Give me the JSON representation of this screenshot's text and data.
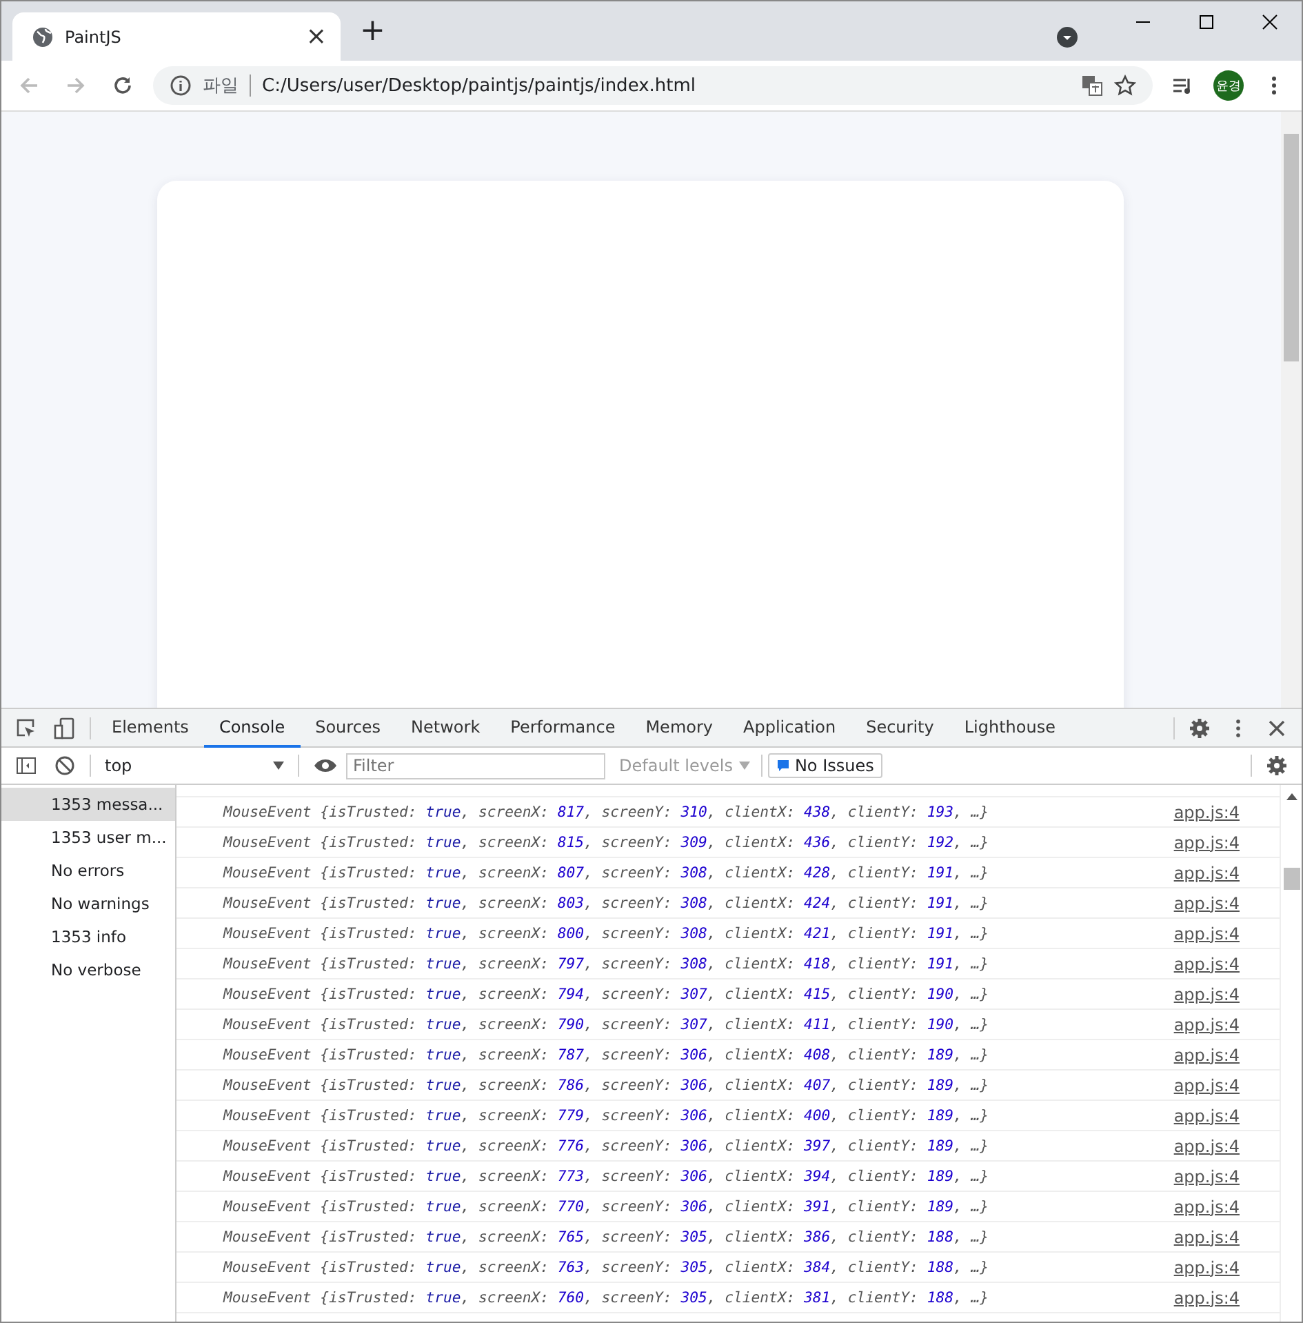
{
  "browser": {
    "tab": {
      "title": "PaintJS",
      "close": "×"
    },
    "new_tab": "+",
    "address": {
      "scheme_label": "파일",
      "url": "C:/Users/user/Desktop/paintjs/paintjs/index.html"
    },
    "profile": "윤경"
  },
  "devtools": {
    "tabs": [
      {
        "label": "Elements",
        "selected": false
      },
      {
        "label": "Console",
        "selected": true
      },
      {
        "label": "Sources",
        "selected": false
      },
      {
        "label": "Network",
        "selected": false
      },
      {
        "label": "Performance",
        "selected": false
      },
      {
        "label": "Memory",
        "selected": false
      },
      {
        "label": "Application",
        "selected": false
      },
      {
        "label": "Security",
        "selected": false
      },
      {
        "label": "Lighthouse",
        "selected": false
      }
    ],
    "context": "top",
    "filter_placeholder": "Filter",
    "levels": "Default levels",
    "issues": "No Issues",
    "sidebar": [
      {
        "label": "1353 messa...",
        "selected": true
      },
      {
        "label": "1353 user m...",
        "selected": false
      },
      {
        "label": "No errors",
        "selected": false
      },
      {
        "label": "No warnings",
        "selected": false
      },
      {
        "label": "1353 info",
        "selected": false
      },
      {
        "label": "No verbose",
        "selected": false
      }
    ],
    "messages": [
      {
        "parts": [
          {
            "text": "MouseEvent {isTrusted: ",
            "kind": "key"
          },
          {
            "text": "true",
            "kind": "bool"
          },
          {
            "text": ", screenX: ",
            "kind": "key"
          },
          {
            "text": "817",
            "kind": "num"
          },
          {
            "text": ", screenY: ",
            "kind": "key"
          },
          {
            "text": "310",
            "kind": "num"
          },
          {
            "text": ", clientX: ",
            "kind": "key"
          },
          {
            "text": "438",
            "kind": "num"
          },
          {
            "text": ", clientY: ",
            "kind": "key"
          },
          {
            "text": "193",
            "kind": "num"
          },
          {
            "text": ", …}",
            "kind": "key"
          }
        ],
        "source": "app.js:4"
      },
      {
        "parts": [
          {
            "text": "MouseEvent {isTrusted: ",
            "kind": "key"
          },
          {
            "text": "true",
            "kind": "bool"
          },
          {
            "text": ", screenX: ",
            "kind": "key"
          },
          {
            "text": "815",
            "kind": "num"
          },
          {
            "text": ", screenY: ",
            "kind": "key"
          },
          {
            "text": "309",
            "kind": "num"
          },
          {
            "text": ", clientX: ",
            "kind": "key"
          },
          {
            "text": "436",
            "kind": "num"
          },
          {
            "text": ", clientY: ",
            "kind": "key"
          },
          {
            "text": "192",
            "kind": "num"
          },
          {
            "text": ", …}",
            "kind": "key"
          }
        ],
        "source": "app.js:4"
      },
      {
        "parts": [
          {
            "text": "MouseEvent {isTrusted: ",
            "kind": "key"
          },
          {
            "text": "true",
            "kind": "bool"
          },
          {
            "text": ", screenX: ",
            "kind": "key"
          },
          {
            "text": "807",
            "kind": "num"
          },
          {
            "text": ", screenY: ",
            "kind": "key"
          },
          {
            "text": "308",
            "kind": "num"
          },
          {
            "text": ", clientX: ",
            "kind": "key"
          },
          {
            "text": "428",
            "kind": "num"
          },
          {
            "text": ", clientY: ",
            "kind": "key"
          },
          {
            "text": "191",
            "kind": "num"
          },
          {
            "text": ", …}",
            "kind": "key"
          }
        ],
        "source": "app.js:4"
      },
      {
        "parts": [
          {
            "text": "MouseEvent {isTrusted: ",
            "kind": "key"
          },
          {
            "text": "true",
            "kind": "bool"
          },
          {
            "text": ", screenX: ",
            "kind": "key"
          },
          {
            "text": "803",
            "kind": "num"
          },
          {
            "text": ", screenY: ",
            "kind": "key"
          },
          {
            "text": "308",
            "kind": "num"
          },
          {
            "text": ", clientX: ",
            "kind": "key"
          },
          {
            "text": "424",
            "kind": "num"
          },
          {
            "text": ", clientY: ",
            "kind": "key"
          },
          {
            "text": "191",
            "kind": "num"
          },
          {
            "text": ", …}",
            "kind": "key"
          }
        ],
        "source": "app.js:4"
      },
      {
        "parts": [
          {
            "text": "MouseEvent {isTrusted: ",
            "kind": "key"
          },
          {
            "text": "true",
            "kind": "bool"
          },
          {
            "text": ", screenX: ",
            "kind": "key"
          },
          {
            "text": "800",
            "kind": "num"
          },
          {
            "text": ", screenY: ",
            "kind": "key"
          },
          {
            "text": "308",
            "kind": "num"
          },
          {
            "text": ", clientX: ",
            "kind": "key"
          },
          {
            "text": "421",
            "kind": "num"
          },
          {
            "text": ", clientY: ",
            "kind": "key"
          },
          {
            "text": "191",
            "kind": "num"
          },
          {
            "text": ", …}",
            "kind": "key"
          }
        ],
        "source": "app.js:4"
      },
      {
        "parts": [
          {
            "text": "MouseEvent {isTrusted: ",
            "kind": "key"
          },
          {
            "text": "true",
            "kind": "bool"
          },
          {
            "text": ", screenX: ",
            "kind": "key"
          },
          {
            "text": "797",
            "kind": "num"
          },
          {
            "text": ", screenY: ",
            "kind": "key"
          },
          {
            "text": "308",
            "kind": "num"
          },
          {
            "text": ", clientX: ",
            "kind": "key"
          },
          {
            "text": "418",
            "kind": "num"
          },
          {
            "text": ", clientY: ",
            "kind": "key"
          },
          {
            "text": "191",
            "kind": "num"
          },
          {
            "text": ", …}",
            "kind": "key"
          }
        ],
        "source": "app.js:4"
      },
      {
        "parts": [
          {
            "text": "MouseEvent {isTrusted: ",
            "kind": "key"
          },
          {
            "text": "true",
            "kind": "bool"
          },
          {
            "text": ", screenX: ",
            "kind": "key"
          },
          {
            "text": "794",
            "kind": "num"
          },
          {
            "text": ", screenY: ",
            "kind": "key"
          },
          {
            "text": "307",
            "kind": "num"
          },
          {
            "text": ", clientX: ",
            "kind": "key"
          },
          {
            "text": "415",
            "kind": "num"
          },
          {
            "text": ", clientY: ",
            "kind": "key"
          },
          {
            "text": "190",
            "kind": "num"
          },
          {
            "text": ", …}",
            "kind": "key"
          }
        ],
        "source": "app.js:4"
      },
      {
        "parts": [
          {
            "text": "MouseEvent {isTrusted: ",
            "kind": "key"
          },
          {
            "text": "true",
            "kind": "bool"
          },
          {
            "text": ", screenX: ",
            "kind": "key"
          },
          {
            "text": "790",
            "kind": "num"
          },
          {
            "text": ", screenY: ",
            "kind": "key"
          },
          {
            "text": "307",
            "kind": "num"
          },
          {
            "text": ", clientX: ",
            "kind": "key"
          },
          {
            "text": "411",
            "kind": "num"
          },
          {
            "text": ", clientY: ",
            "kind": "key"
          },
          {
            "text": "190",
            "kind": "num"
          },
          {
            "text": ", …}",
            "kind": "key"
          }
        ],
        "source": "app.js:4"
      },
      {
        "parts": [
          {
            "text": "MouseEvent {isTrusted: ",
            "kind": "key"
          },
          {
            "text": "true",
            "kind": "bool"
          },
          {
            "text": ", screenX: ",
            "kind": "key"
          },
          {
            "text": "787",
            "kind": "num"
          },
          {
            "text": ", screenY: ",
            "kind": "key"
          },
          {
            "text": "306",
            "kind": "num"
          },
          {
            "text": ", clientX: ",
            "kind": "key"
          },
          {
            "text": "408",
            "kind": "num"
          },
          {
            "text": ", clientY: ",
            "kind": "key"
          },
          {
            "text": "189",
            "kind": "num"
          },
          {
            "text": ", …}",
            "kind": "key"
          }
        ],
        "source": "app.js:4"
      },
      {
        "parts": [
          {
            "text": "MouseEvent {isTrusted: ",
            "kind": "key"
          },
          {
            "text": "true",
            "kind": "bool"
          },
          {
            "text": ", screenX: ",
            "kind": "key"
          },
          {
            "text": "786",
            "kind": "num"
          },
          {
            "text": ", screenY: ",
            "kind": "key"
          },
          {
            "text": "306",
            "kind": "num"
          },
          {
            "text": ", clientX: ",
            "kind": "key"
          },
          {
            "text": "407",
            "kind": "num"
          },
          {
            "text": ", clientY: ",
            "kind": "key"
          },
          {
            "text": "189",
            "kind": "num"
          },
          {
            "text": ", …}",
            "kind": "key"
          }
        ],
        "source": "app.js:4"
      },
      {
        "parts": [
          {
            "text": "MouseEvent {isTrusted: ",
            "kind": "key"
          },
          {
            "text": "true",
            "kind": "bool"
          },
          {
            "text": ", screenX: ",
            "kind": "key"
          },
          {
            "text": "779",
            "kind": "num"
          },
          {
            "text": ", screenY: ",
            "kind": "key"
          },
          {
            "text": "306",
            "kind": "num"
          },
          {
            "text": ", clientX: ",
            "kind": "key"
          },
          {
            "text": "400",
            "kind": "num"
          },
          {
            "text": ", clientY: ",
            "kind": "key"
          },
          {
            "text": "189",
            "kind": "num"
          },
          {
            "text": ", …}",
            "kind": "key"
          }
        ],
        "source": "app.js:4"
      },
      {
        "parts": [
          {
            "text": "MouseEvent {isTrusted: ",
            "kind": "key"
          },
          {
            "text": "true",
            "kind": "bool"
          },
          {
            "text": ", screenX: ",
            "kind": "key"
          },
          {
            "text": "776",
            "kind": "num"
          },
          {
            "text": ", screenY: ",
            "kind": "key"
          },
          {
            "text": "306",
            "kind": "num"
          },
          {
            "text": ", clientX: ",
            "kind": "key"
          },
          {
            "text": "397",
            "kind": "num"
          },
          {
            "text": ", clientY: ",
            "kind": "key"
          },
          {
            "text": "189",
            "kind": "num"
          },
          {
            "text": ", …}",
            "kind": "key"
          }
        ],
        "source": "app.js:4"
      },
      {
        "parts": [
          {
            "text": "MouseEvent {isTrusted: ",
            "kind": "key"
          },
          {
            "text": "true",
            "kind": "bool"
          },
          {
            "text": ", screenX: ",
            "kind": "key"
          },
          {
            "text": "773",
            "kind": "num"
          },
          {
            "text": ", screenY: ",
            "kind": "key"
          },
          {
            "text": "306",
            "kind": "num"
          },
          {
            "text": ", clientX: ",
            "kind": "key"
          },
          {
            "text": "394",
            "kind": "num"
          },
          {
            "text": ", clientY: ",
            "kind": "key"
          },
          {
            "text": "189",
            "kind": "num"
          },
          {
            "text": ", …}",
            "kind": "key"
          }
        ],
        "source": "app.js:4"
      },
      {
        "parts": [
          {
            "text": "MouseEvent {isTrusted: ",
            "kind": "key"
          },
          {
            "text": "true",
            "kind": "bool"
          },
          {
            "text": ", screenX: ",
            "kind": "key"
          },
          {
            "text": "770",
            "kind": "num"
          },
          {
            "text": ", screenY: ",
            "kind": "key"
          },
          {
            "text": "306",
            "kind": "num"
          },
          {
            "text": ", clientX: ",
            "kind": "key"
          },
          {
            "text": "391",
            "kind": "num"
          },
          {
            "text": ", clientY: ",
            "kind": "key"
          },
          {
            "text": "189",
            "kind": "num"
          },
          {
            "text": ", …}",
            "kind": "key"
          }
        ],
        "source": "app.js:4"
      },
      {
        "parts": [
          {
            "text": "MouseEvent {isTrusted: ",
            "kind": "key"
          },
          {
            "text": "true",
            "kind": "bool"
          },
          {
            "text": ", screenX: ",
            "kind": "key"
          },
          {
            "text": "765",
            "kind": "num"
          },
          {
            "text": ", screenY: ",
            "kind": "key"
          },
          {
            "text": "305",
            "kind": "num"
          },
          {
            "text": ", clientX: ",
            "kind": "key"
          },
          {
            "text": "386",
            "kind": "num"
          },
          {
            "text": ", clientY: ",
            "kind": "key"
          },
          {
            "text": "188",
            "kind": "num"
          },
          {
            "text": ", …}",
            "kind": "key"
          }
        ],
        "source": "app.js:4"
      },
      {
        "parts": [
          {
            "text": "MouseEvent {isTrusted: ",
            "kind": "key"
          },
          {
            "text": "true",
            "kind": "bool"
          },
          {
            "text": ", screenX: ",
            "kind": "key"
          },
          {
            "text": "763",
            "kind": "num"
          },
          {
            "text": ", screenY: ",
            "kind": "key"
          },
          {
            "text": "305",
            "kind": "num"
          },
          {
            "text": ", clientX: ",
            "kind": "key"
          },
          {
            "text": "384",
            "kind": "num"
          },
          {
            "text": ", clientY: ",
            "kind": "key"
          },
          {
            "text": "188",
            "kind": "num"
          },
          {
            "text": ", …}",
            "kind": "key"
          }
        ],
        "source": "app.js:4"
      },
      {
        "parts": [
          {
            "text": "MouseEvent {isTrusted: ",
            "kind": "key"
          },
          {
            "text": "true",
            "kind": "bool"
          },
          {
            "text": ", screenX: ",
            "kind": "key"
          },
          {
            "text": "760",
            "kind": "num"
          },
          {
            "text": ", screenY: ",
            "kind": "key"
          },
          {
            "text": "305",
            "kind": "num"
          },
          {
            "text": ", clientX: ",
            "kind": "key"
          },
          {
            "text": "381",
            "kind": "num"
          },
          {
            "text": ", clientY: ",
            "kind": "key"
          },
          {
            "text": "188",
            "kind": "num"
          },
          {
            "text": ", …}",
            "kind": "key"
          }
        ],
        "source": "app.js:4"
      }
    ]
  }
}
